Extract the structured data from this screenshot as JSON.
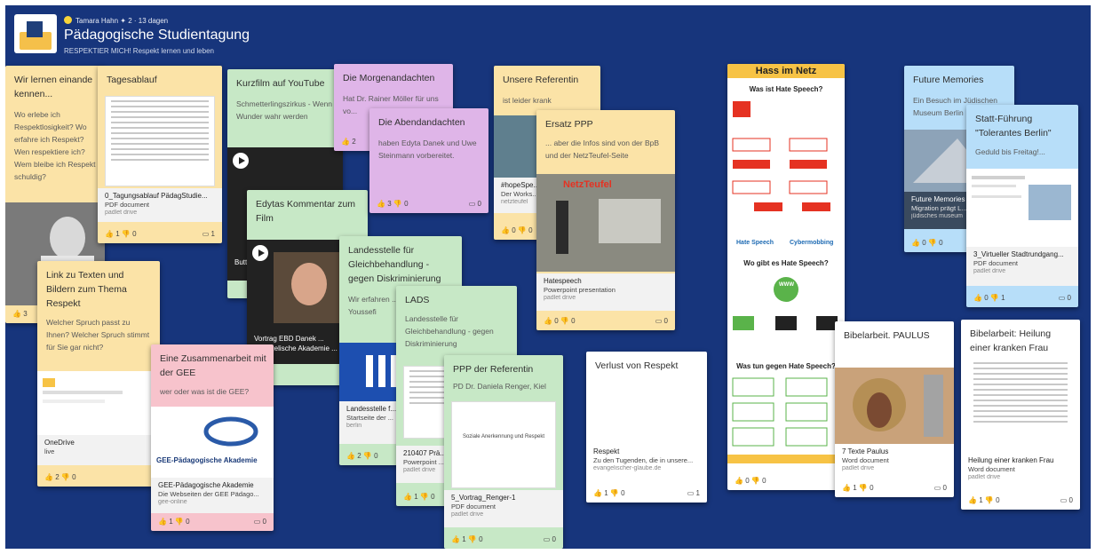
{
  "header": {
    "author": "Tamara Hahn",
    "meta": "✦ 2 · 13 dagen",
    "title": "Pädagogische Studientagung",
    "subtitle": "RESPEKTIER MICH! Respekt lernen und leben"
  },
  "colors": {
    "board_bg": "#17357c",
    "yellow": "#fbe3a7",
    "green": "#c7e8c6",
    "purple": "#dfb5e8",
    "blue": "#b7def9",
    "pink": "#f7c3cc",
    "orange": "#f7c345"
  },
  "icons": {
    "like": "thumbs-up-icon",
    "dislike": "thumbs-down-icon",
    "comment": "comment-icon",
    "play": "play-icon"
  },
  "cards": {
    "wir": {
      "title": "Wir lernen einande kennen...",
      "body": "Wo erlebe ich Respektlosigkeit? Wo erfahre ich Respekt? Wen respektiere ich? Wem bleibe ich Respekt schuldig?",
      "likes": "3"
    },
    "tagesablauf": {
      "title": "Tagesablauf",
      "att_name": "0_Tagungsablauf PädagStudie...",
      "att_type": "PDF document",
      "att_src": "padlet drive",
      "likes": "1",
      "dislikes": "0",
      "comments": "1"
    },
    "link": {
      "title": "Link zu Texten und Bildern zum Thema Respekt",
      "body": "Welcher Spruch passt zu Ihnen? Welcher Spruch stimmt für Sie gar nicht?",
      "att_name": "OneDrive",
      "att_src": "live",
      "likes": "2",
      "dislikes": "0"
    },
    "kurzfilm": {
      "title": "Kurzfilm auf YouTube",
      "body": "Schmetterlingszirkus - Wenn Wunder wahr werden",
      "vid_caption": "Butt... by D..."
    },
    "edyta": {
      "title": "Edytas Kommentar zum Film",
      "vid_caption": "Vortrag EBD Danek ... Evangelische Akademie ... ube",
      "dislikes": "0"
    },
    "morgen": {
      "title": "Die Morgenandachten",
      "body": "Hat Dr. Rainer Möller für uns vo...",
      "likes": "2"
    },
    "abend": {
      "title": "Die Abendandachten",
      "body": "haben Edyta Danek und Uwe Steinmann vorbereitet.",
      "likes": "3",
      "dislikes": "0",
      "comments": "0"
    },
    "landesstelle": {
      "title": "Landesstelle für Gleichbehandlung - gegen Diskriminierung",
      "body": "Wir erfahren ... von Referen... Youssefi",
      "att_name": "Landesstelle f...",
      "att_type": "Startseite der ...",
      "att_src": "berlin",
      "likes": "2",
      "dislikes": "0"
    },
    "lads": {
      "title": "LADS",
      "body": "Landesstelle für Gleichbehandlung - gegen Diskriminierung",
      "att_name": "210407 Prä...",
      "att_type": "Powerpoint ...",
      "att_src": "padlet drive",
      "likes": "1",
      "dislikes": "0"
    },
    "ppp_ref": {
      "title": "PPP der Referentin",
      "body": "PD Dr. Daniela Renger, Kiel",
      "preview_text": "Soziale Anerkennung und Respekt",
      "att_name": "5_Vortrag_Renger-1",
      "att_type": "PDF document",
      "att_src": "padlet drive",
      "likes": "1",
      "dislikes": "0",
      "comments": "0"
    },
    "zusammen": {
      "title": "Eine Zusammenarbeit mit der GEE",
      "body": "wer oder was ist die GEE?",
      "img_label": "GEE-Pädagogische Akademie",
      "att_name": "GEE-Pädagogische Akademie",
      "att_type": "Die Webseiten der GEE Pädago...",
      "att_src": "gee-online",
      "likes": "1",
      "dislikes": "0",
      "comments": "0"
    },
    "referentin": {
      "title": "Unsere Referentin",
      "body": "ist leider krank",
      "att_name": "#hopeSpe...",
      "att_type": "Der Works...",
      "att_src": "netzteufel",
      "likes": "0",
      "dislikes": "0"
    },
    "ersatz": {
      "title": "Ersatz PPP",
      "body": "... aber die Infos sind von der BpB und der NetzTeufel-Seite",
      "img_label": "NetzTeufel",
      "att_name": "Hatespeech",
      "att_type": "Powerpoint presentation",
      "att_src": "padlet drive",
      "likes": "0",
      "dislikes": "0",
      "comments": "0"
    },
    "verlust": {
      "title": "Verlust von Respekt",
      "att_name": "Respekt",
      "att_type": "Zu den Tugenden, die in unsere...",
      "att_src": "evangelischer-glaube.de",
      "likes": "1",
      "dislikes": "0",
      "comments": "1"
    },
    "hass": {
      "title": "Hass im Netz",
      "q1": "Was ist Hate Speech?",
      "q2": "Wo gibt es Hate Speech?",
      "q3": "Was tun gegen Hate Speech?",
      "label_hs": "Hate Speech",
      "label_cm": "Cybermobbing",
      "label_www": "WWW",
      "likes": "0",
      "dislikes": "0"
    },
    "paulus": {
      "title": "Bibelarbeit. PAULUS",
      "att_name": "7 Texte Paulus",
      "att_type": "Word document",
      "att_src": "padlet drive",
      "likes": "1",
      "dislikes": "0",
      "comments": "0"
    },
    "heilung": {
      "title": "Bibelarbeit: Heilung einer kranken Frau",
      "att_name": "Heilung einer kranken Frau",
      "att_type": "Word document",
      "att_src": "padlet drive",
      "likes": "1",
      "dislikes": "0",
      "comments": "0"
    },
    "future": {
      "title": "Future Memories",
      "body": "Ein Besuch im Jüdischen Museum Berlin",
      "att_name": "Future Memories",
      "att_type": "Migration prägt L...",
      "att_src": "jüdisches museum",
      "likes": "0",
      "dislikes": "0"
    },
    "statt": {
      "title": "Statt-Führung \"Tolerantes Berlin\"",
      "body": "Geduld bis Freitag!...",
      "att_name": "3_Virtueller Stadtrundgang...",
      "att_type": "PDF document",
      "att_src": "padlet drive",
      "likes": "0",
      "dislikes": "1",
      "comments": "0"
    }
  }
}
